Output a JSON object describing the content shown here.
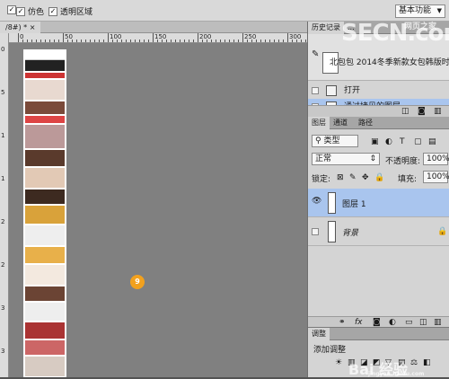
{
  "options_bar": {
    "checkbox1_label": "",
    "checkbox2_label": "仿色",
    "checkbox3_label": "透明区域",
    "workspace": "基本功能"
  },
  "document": {
    "tab_label": "/8#) * ×"
  },
  "rulers": {
    "horizontal_labels": [
      "0",
      "50",
      "100",
      "150",
      "200",
      "250",
      "300"
    ],
    "vertical_labels": [
      "0",
      "5",
      "1",
      "1",
      "2",
      "2",
      "3",
      "3"
    ]
  },
  "history_panel": {
    "tabs": [
      "历史记录",
      "..."
    ],
    "snapshot_label": "北包包 2014冬季新款女包韩版时...",
    "states": [
      "打开",
      "通过拷贝的图层"
    ]
  },
  "layers_panel": {
    "tabs": [
      "图层",
      "通道",
      "路径"
    ],
    "filter_label": "类型",
    "blend_mode": "正常",
    "opacity_label": "不透明度:",
    "opacity_value": "100%",
    "lock_label": "锁定:",
    "fill_label": "填充:",
    "fill_value": "100%",
    "layers": [
      {
        "name": "图层 1",
        "visible": true,
        "selected": true
      },
      {
        "name": "背景",
        "visible": false,
        "selected": false,
        "locked": true
      }
    ],
    "footer_icons": [
      "link-icon",
      "fx-icon",
      "mask-icon",
      "adjustment-icon",
      "folder-icon",
      "new-layer-icon",
      "trash-icon"
    ]
  },
  "adjustments_panel": {
    "tab": "调整",
    "title": "添加调整"
  },
  "badge_count": "9",
  "watermarks": {
    "top": "SECN.com",
    "top_small": "网页之家",
    "bottom": "Bai 经验",
    "bottom_small": "jingyan.baidu.com"
  },
  "colors": {
    "selection": "#a9c5ee",
    "badge": "#f2a11e"
  }
}
